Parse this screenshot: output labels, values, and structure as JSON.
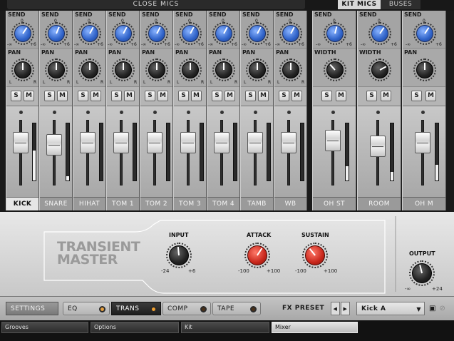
{
  "header": {
    "close_mics": "CLOSE MICS",
    "kit_mics": "KIT MICS",
    "buses": "BUSES"
  },
  "labels": {
    "send": "SEND",
    "pan": "PAN",
    "width": "WIDTH",
    "s": "S",
    "m": "M",
    "inf": "-∞",
    "plus6": "+6",
    "zero": "0",
    "l": "L",
    "r": "R"
  },
  "channels": [
    {
      "name": "KICK",
      "send": 0.62,
      "pan": 0.5,
      "fader": 0.72,
      "meter": 0.53,
      "selected": true
    },
    {
      "name": "SNARE",
      "send": 0.58,
      "pan": 0.5,
      "fader": 0.68,
      "meter": 0.08
    },
    {
      "name": "HIHAT",
      "send": 0.6,
      "pan": 0.5,
      "fader": 0.72,
      "meter": 0
    },
    {
      "name": "TOM 1",
      "send": 0.6,
      "pan": 0.5,
      "fader": 0.72,
      "meter": 0
    },
    {
      "name": "TOM 2",
      "send": 0.6,
      "pan": 0.5,
      "fader": 0.72,
      "meter": 0
    },
    {
      "name": "TOM 3",
      "send": 0.6,
      "pan": 0.5,
      "fader": 0.72,
      "meter": 0
    },
    {
      "name": "TOM 4",
      "send": 0.6,
      "pan": 0.5,
      "fader": 0.72,
      "meter": 0
    },
    {
      "name": "TAMB",
      "send": 0.6,
      "pan": 0.5,
      "fader": 0.72,
      "meter": 0
    },
    {
      "name": "WB",
      "send": 0.6,
      "pan": 0.5,
      "fader": 0.72,
      "meter": 0
    }
  ],
  "buses": [
    {
      "name": "OH ST",
      "send": 0.55,
      "knob2": "width",
      "value2": 0.35,
      "fader": 0.78,
      "meter": 0.25
    },
    {
      "name": "ROOM",
      "send": 0.62,
      "knob2": "width",
      "value2": 0.72,
      "fader": 0.65,
      "meter": 0.15
    },
    {
      "name": "OH M",
      "send": 0.62,
      "knob2": "pan",
      "value2": 0.5,
      "fader": 0.72,
      "meter": 0.27
    }
  ],
  "transient": {
    "title_1": "TRANSIENT",
    "title_2": "MASTER",
    "input_label": "INPUT",
    "input_min": "-24",
    "input_max": "+6",
    "input_value": 0.48,
    "attack_label": "ATTACK",
    "attack_min": "-100",
    "attack_max": "+100",
    "attack_value": 0.62,
    "sustain_label": "SUSTAIN",
    "sustain_min": "-100",
    "sustain_max": "+100",
    "sustain_value": 0.36,
    "output_label": "OUTPUT",
    "output_min": "-∞",
    "output_max": "+24",
    "output_value": 0.45
  },
  "fxbar": {
    "settings": "SETTINGS",
    "eq": "EQ",
    "trans": "TRANS",
    "comp": "COMP",
    "tape": "TAPE",
    "preset_label": "FX PRESET",
    "preset_value": "Kick A",
    "accent": "#e08a2a"
  },
  "tabs": {
    "grooves": "Grooves",
    "options": "Options",
    "kit": "Kit",
    "mixer": "Mixer"
  }
}
